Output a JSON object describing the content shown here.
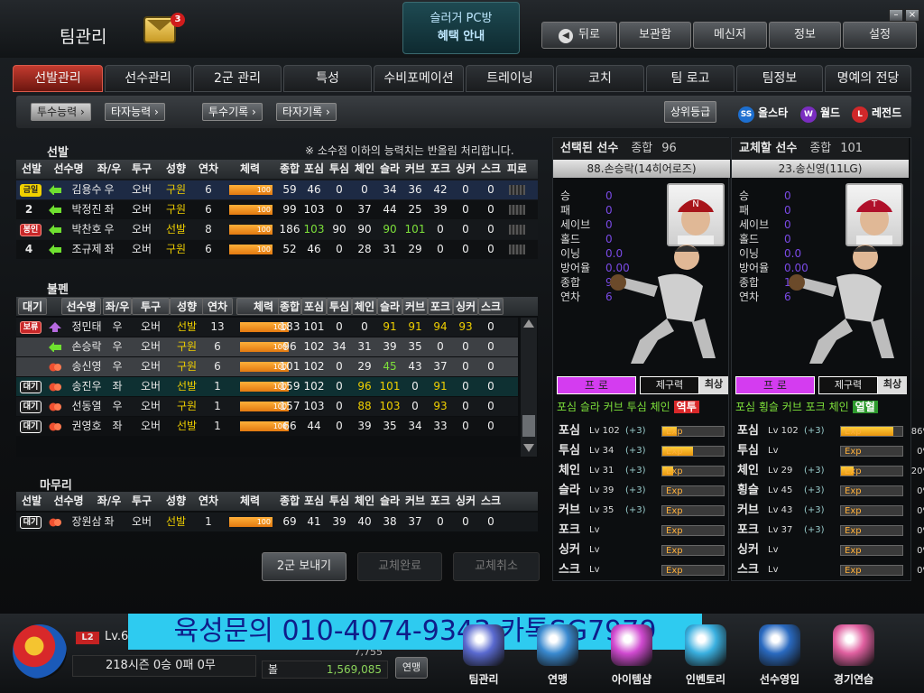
{
  "header": {
    "title": "팀관리",
    "mail_count": "3",
    "promo_line1": "슬러거 PC방",
    "promo_line2": "혜택 안내",
    "buttons": [
      "뒤로",
      "보관함",
      "메신저",
      "정보",
      "설정"
    ]
  },
  "tabs": [
    "선발관리",
    "선수관리",
    "2군 관리",
    "특성",
    "수비포메이션",
    "트레이닝",
    "코치",
    "팀 로고",
    "팀정보",
    "명예의 전당"
  ],
  "subtabs": [
    "투수능력",
    "타자능력",
    "투수기록",
    "타자기록"
  ],
  "grade": {
    "label": "상위등급",
    "allstar": "올스타",
    "world": "월드",
    "legend": "레전드"
  },
  "starters": {
    "title": "선발",
    "note": "※ 소수점 이하의 능력치는 반올림 처리합니다.",
    "headers": [
      "선발",
      "선수명",
      "좌/우",
      "투구",
      "성향",
      "연차",
      "체력",
      "종합",
      "포심",
      "투심",
      "체인",
      "슬라",
      "커브",
      "포크",
      "싱커",
      "스크",
      "피로"
    ],
    "rows": [
      {
        "slot": "금일",
        "name": "김용수",
        "hand": "우",
        "delivery": "오버",
        "style": "구원",
        "years": "6",
        "stamina": "100",
        "stats": [
          "59",
          "46",
          "0",
          "0",
          "34",
          "36",
          "42",
          "0",
          "0"
        ]
      },
      {
        "slot": "2",
        "name": "박정진",
        "hand": "좌",
        "delivery": "오버",
        "style": "구원",
        "years": "6",
        "stamina": "100",
        "stats": [
          "99",
          "103",
          "0",
          "37",
          "44",
          "25",
          "39",
          "0",
          "0"
        ]
      },
      {
        "slot": "봉인",
        "name": "박찬호",
        "hand": "우",
        "delivery": "오버",
        "style": "선발",
        "years": "8",
        "stamina": "100",
        "stats": [
          "186",
          "103",
          "90",
          "90",
          "90",
          "101",
          "0",
          "0",
          "0"
        ]
      },
      {
        "slot": "4",
        "name": "조규제",
        "hand": "좌",
        "delivery": "오버",
        "style": "구원",
        "years": "6",
        "stamina": "100",
        "stats": [
          "52",
          "46",
          "0",
          "28",
          "31",
          "29",
          "0",
          "0",
          "0"
        ]
      }
    ]
  },
  "bullpen": {
    "title": "불펜",
    "headers": [
      "대기",
      "선수명",
      "좌/우",
      "투구",
      "성향",
      "연차",
      "체력",
      "종합",
      "포심",
      "투심",
      "체인",
      "슬라",
      "커브",
      "포크",
      "싱커",
      "스크"
    ],
    "rows": [
      {
        "slot": "보류",
        "name": "정민태",
        "hand": "우",
        "delivery": "오버",
        "style": "선발",
        "years": "13",
        "stamina": "100",
        "stats": [
          "183",
          "101",
          "0",
          "0",
          "91",
          "91",
          "94",
          "93",
          "0"
        ]
      },
      {
        "slot": "",
        "name": "손승락",
        "hand": "우",
        "delivery": "오버",
        "style": "구원",
        "years": "6",
        "stamina": "100",
        "stats": [
          "96",
          "102",
          "34",
          "31",
          "39",
          "35",
          "0",
          "0",
          "0"
        ]
      },
      {
        "slot": "",
        "name": "송신영",
        "hand": "우",
        "delivery": "오버",
        "style": "구원",
        "years": "6",
        "stamina": "100",
        "stats": [
          "101",
          "102",
          "0",
          "29",
          "45",
          "43",
          "37",
          "0",
          "0"
        ]
      },
      {
        "slot": "대기",
        "name": "송진우",
        "hand": "좌",
        "delivery": "오버",
        "style": "선발",
        "years": "1",
        "stamina": "100",
        "stats": [
          "159",
          "102",
          "0",
          "96",
          "101",
          "0",
          "91",
          "0",
          "0"
        ]
      },
      {
        "slot": "대기",
        "name": "선동열",
        "hand": "우",
        "delivery": "오버",
        "style": "구원",
        "years": "1",
        "stamina": "100",
        "stats": [
          "157",
          "103",
          "0",
          "88",
          "103",
          "0",
          "93",
          "0",
          "0"
        ]
      },
      {
        "slot": "대기",
        "name": "권영호",
        "hand": "좌",
        "delivery": "오버",
        "style": "선발",
        "years": "1",
        "stamina": "100",
        "stats": [
          "66",
          "44",
          "0",
          "39",
          "35",
          "34",
          "33",
          "0",
          "0"
        ]
      }
    ]
  },
  "closer": {
    "title": "마무리",
    "headers": [
      "선발",
      "선수명",
      "좌/우",
      "투구",
      "성향",
      "연차",
      "체력",
      "종합",
      "포심",
      "투심",
      "체인",
      "슬라",
      "커브",
      "포크",
      "싱커",
      "스크"
    ],
    "rows": [
      {
        "slot": "대기",
        "name": "장원삼",
        "hand": "좌",
        "delivery": "오버",
        "style": "선발",
        "years": "1",
        "stamina": "100",
        "stats": [
          "69",
          "41",
          "39",
          "40",
          "38",
          "37",
          "0",
          "0",
          "0"
        ]
      }
    ]
  },
  "actions": {
    "send": "2군 보내기",
    "done": "교체완료",
    "cancel": "교체취소"
  },
  "selected": {
    "title": "선택된 선수",
    "total_label": "종합",
    "total": "96",
    "name": "88.손승락(14히어로즈)",
    "stat_labels": [
      "승",
      "패",
      "세이브",
      "홀드",
      "이닝",
      "방어율",
      "종합",
      "연차"
    ],
    "stat_values": [
      "0",
      "0",
      "0",
      "0",
      "0.0",
      "0.00",
      "96",
      "6"
    ],
    "role": "프 로",
    "control_label": "제구력",
    "control": "최상",
    "pitches_line": "포심 슬라 커브 투심 체인",
    "pitch_tag": "역투",
    "levels": [
      {
        "pitch": "포심",
        "lv": "Lv 102",
        "bonus": "(+3)",
        "exp": "24%",
        "fill": 0.24
      },
      {
        "pitch": "투심",
        "lv": "Lv 34",
        "bonus": "(+3)",
        "exp": "50%",
        "fill": 0.5
      },
      {
        "pitch": "체인",
        "lv": "Lv 31",
        "bonus": "(+3)",
        "exp": "18%",
        "fill": 0.18
      },
      {
        "pitch": "슬라",
        "lv": "Lv 39",
        "bonus": "(+3)",
        "exp": "0%",
        "fill": 0
      },
      {
        "pitch": "커브",
        "lv": "Lv 35",
        "bonus": "(+3)",
        "exp": "0%",
        "fill": 0
      },
      {
        "pitch": "포크",
        "lv": "Lv",
        "bonus": "",
        "exp": "0%",
        "fill": 0
      },
      {
        "pitch": "싱커",
        "lv": "Lv",
        "bonus": "",
        "exp": "0%",
        "fill": 0
      },
      {
        "pitch": "스크",
        "lv": "Lv",
        "bonus": "",
        "exp": "0%",
        "fill": 0
      }
    ]
  },
  "replace": {
    "title": "교체할 선수",
    "total_label": "종합",
    "total": "101",
    "name": "23.송신영(11LG)",
    "stat_labels": [
      "승",
      "패",
      "세이브",
      "홀드",
      "이닝",
      "방어율",
      "종합",
      "연차"
    ],
    "stat_values": [
      "0",
      "0",
      "0",
      "0",
      "0.0",
      "0.00",
      "101",
      "6"
    ],
    "role": "프 로",
    "control_label": "제구력",
    "control": "최상",
    "pitches_line": "포심 횡슬 커브 포크 체인",
    "pitch_tag": "열혈",
    "levels": [
      {
        "pitch": "포심",
        "lv": "Lv 102",
        "bonus": "(+3)",
        "exp": "86%",
        "fill": 0.86
      },
      {
        "pitch": "투심",
        "lv": "Lv",
        "bonus": "",
        "exp": "0%",
        "fill": 0
      },
      {
        "pitch": "체인",
        "lv": "Lv 29",
        "bonus": "(+3)",
        "exp": "20%",
        "fill": 0.2
      },
      {
        "pitch": "횡슬",
        "lv": "Lv 45",
        "bonus": "(+3)",
        "exp": "0%",
        "fill": 0
      },
      {
        "pitch": "커브",
        "lv": "Lv 43",
        "bonus": "(+3)",
        "exp": "0%",
        "fill": 0
      },
      {
        "pitch": "포크",
        "lv": "Lv 37",
        "bonus": "(+3)",
        "exp": "0%",
        "fill": 0
      },
      {
        "pitch": "싱커",
        "lv": "Lv",
        "bonus": "",
        "exp": "0%",
        "fill": 0
      },
      {
        "pitch": "스크",
        "lv": "Lv",
        "bonus": "",
        "exp": "0%",
        "fill": 0
      }
    ]
  },
  "footer": {
    "level_badge": "L2",
    "level": "Lv.6",
    "season": "218시즌",
    "wins": "0승",
    "draws": "0패",
    "losses": "0무",
    "money_label": "볼",
    "money": "1,569,085",
    "rank_label": "연맹",
    "partial_value": "7,755",
    "nav": [
      "팀관리",
      "연맹",
      "아이템샵",
      "인벤토리",
      "선수영입",
      "경기연습"
    ]
  },
  "ad_text": "육성문의 010-4074-9343 카톡SG7979",
  "colors": {
    "accent_red": "#c33b2f",
    "exp_orange": "#e89410",
    "style_yellow": "#f0d000",
    "green": "#7de03a"
  }
}
